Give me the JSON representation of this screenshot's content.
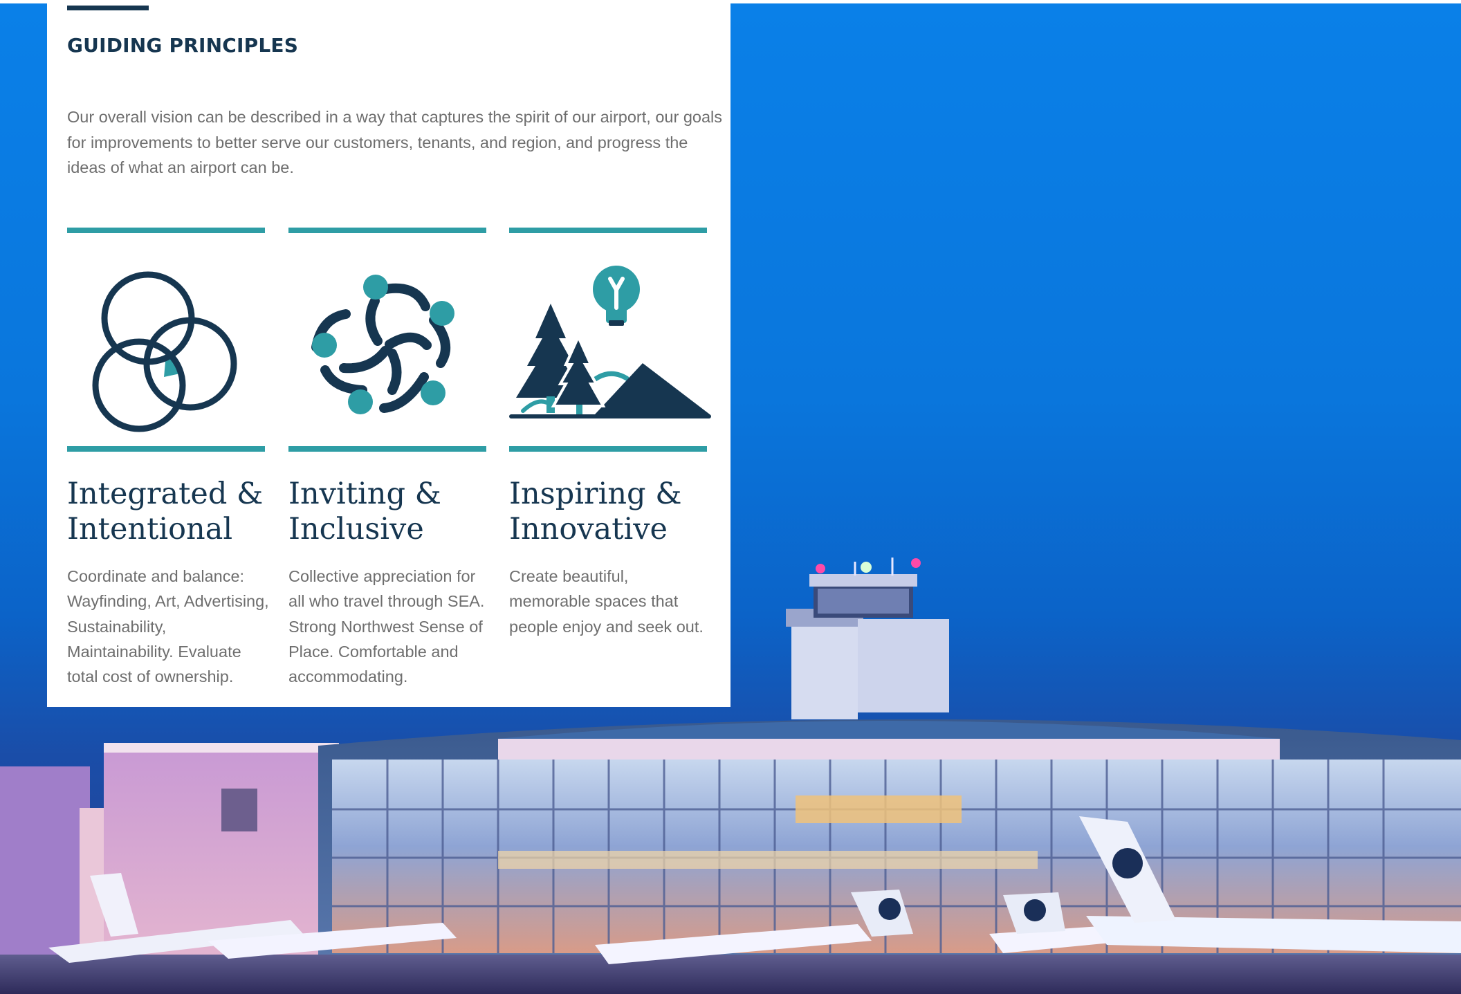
{
  "card": {
    "title": "GUIDING PRINCIPLES",
    "intro": "Our overall vision can be described in a way that captures the spirit of our airport, our goals for improvements to better serve our customers, tenants, and region, and progress the ideas of what an airport can be."
  },
  "principles": [
    {
      "icon": "overlapping-circles-icon",
      "heading_line1": "Integrated &",
      "heading_line2": "Intentional",
      "body": "Coordinate and balance: Wayfinding, Art, Advertising, Sustainability, Maintainability. Evaluate total cost of ownership."
    },
    {
      "icon": "people-circle-icon",
      "heading_line1": "Inviting &",
      "heading_line2": "Inclusive",
      "body": "Collective appreciation for all who travel through SEA. Strong Northwest Sense of Place. Comfortable and accommodating."
    },
    {
      "icon": "trees-mountain-lightbulb-icon",
      "heading_line1": "Inspiring &",
      "heading_line2": "Innovative",
      "body": "Create beautiful, memorable spaces that people enjoy and seek out."
    }
  ],
  "colors": {
    "navy": "#163650",
    "teal": "#2e9da5",
    "body_text": "#6e6e6e",
    "sky_blue": "#0a78de"
  }
}
